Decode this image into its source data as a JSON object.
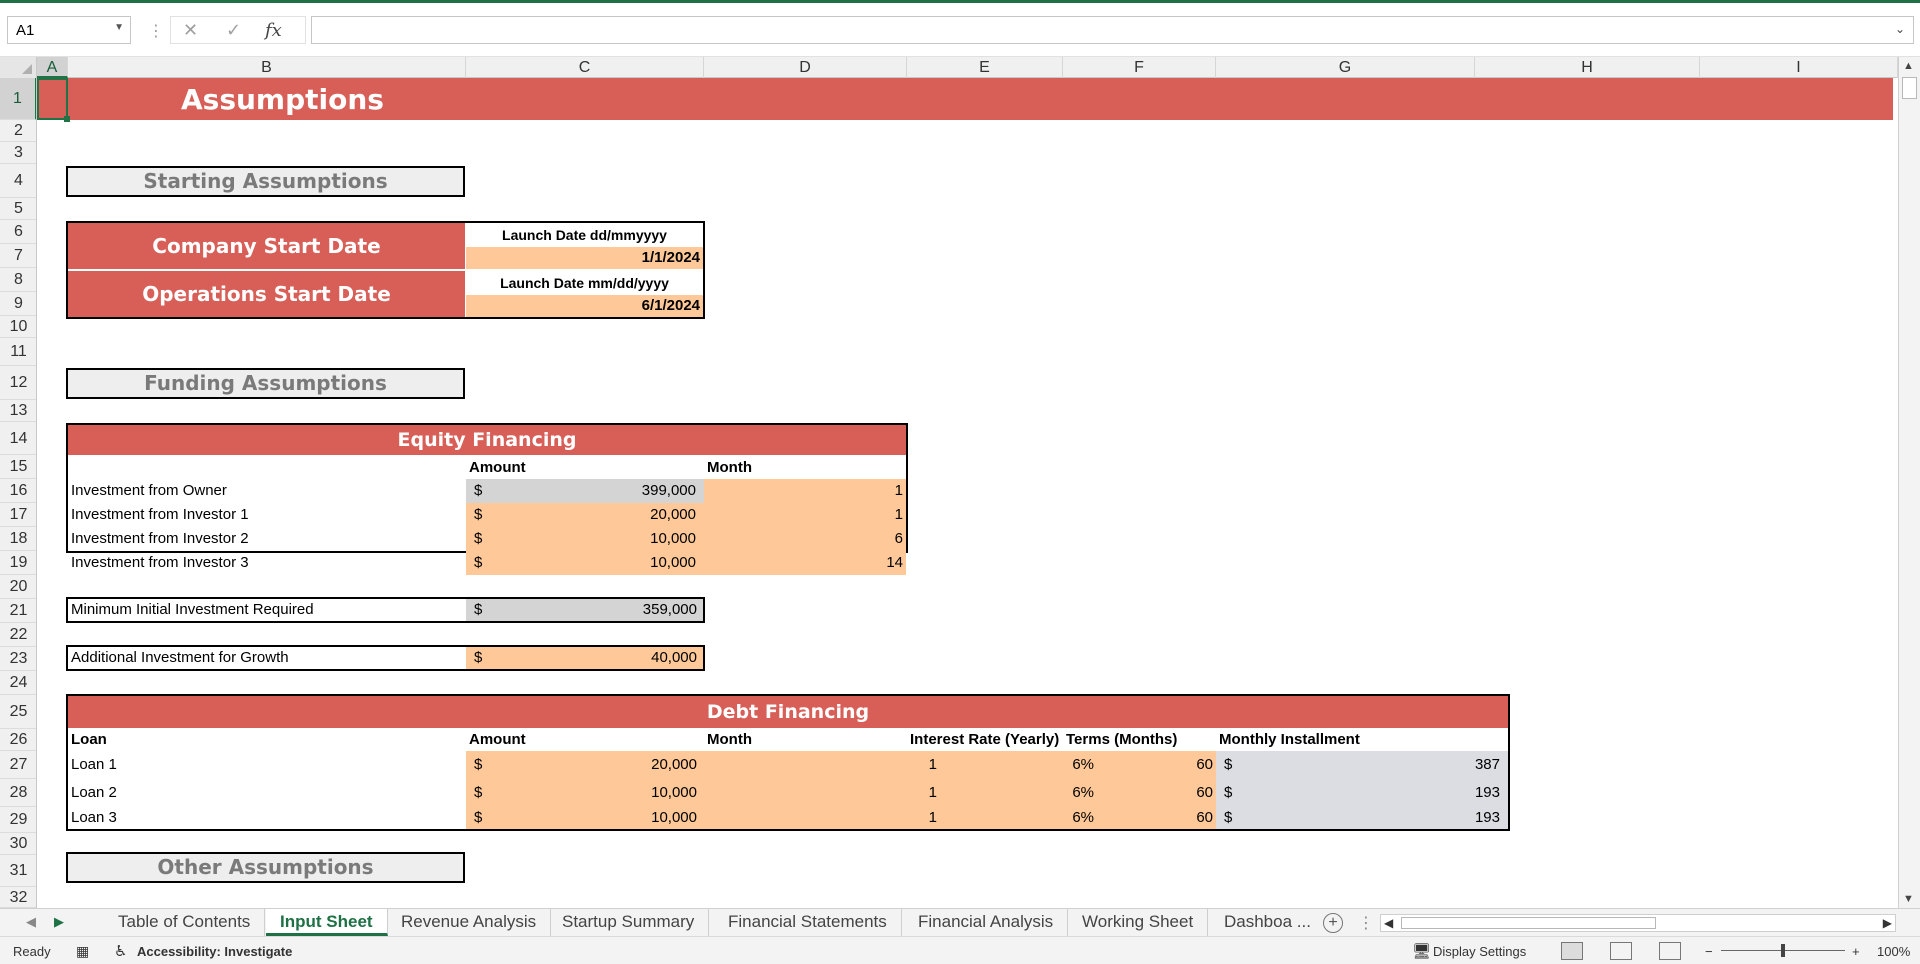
{
  "formula_bar": {
    "name_box": "A1",
    "cancel_icon": "✕",
    "enter_icon": "✓",
    "fx_label": "fx",
    "formula": ""
  },
  "columns": [
    "A",
    "B",
    "C",
    "D",
    "E",
    "F",
    "G",
    "H",
    "I"
  ],
  "rows": [
    "1",
    "2",
    "3",
    "4",
    "5",
    "6",
    "7",
    "8",
    "9",
    "10",
    "11",
    "12",
    "13",
    "14",
    "15",
    "16",
    "17",
    "18",
    "19",
    "20",
    "21",
    "22",
    "23",
    "24",
    "25",
    "26",
    "27",
    "28",
    "29",
    "30",
    "31",
    "32"
  ],
  "sheet": {
    "title": "Assumptions",
    "starting_section": "Starting Assumptions",
    "company_start": {
      "label": "Company Start Date",
      "header": "Launch Date dd/mmyyyy",
      "value": "1/1/2024"
    },
    "operations_start": {
      "label": "Operations Start Date",
      "header": "Launch Date mm/dd/yyyy",
      "value": "6/1/2024"
    },
    "funding_section": "Funding Assumptions",
    "equity": {
      "title": "Equity Financing",
      "amount_header": "Amount",
      "month_header": "Month",
      "rows": [
        {
          "label": "Investment from Owner",
          "currency": "$",
          "amount": "399,000",
          "month": "1"
        },
        {
          "label": "Investment from Investor 1",
          "currency": "$",
          "amount": "20,000",
          "month": "1"
        },
        {
          "label": "Investment from Investor 2",
          "currency": "$",
          "amount": "10,000",
          "month": "6"
        },
        {
          "label": "Investment from Investor 3",
          "currency": "$",
          "amount": "10,000",
          "month": "14"
        }
      ]
    },
    "min_investment": {
      "label": "Minimum Initial Investment Required",
      "currency": "$",
      "amount": "359,000"
    },
    "additional_investment": {
      "label": "Additional Investment for Growth",
      "currency": "$",
      "amount": "40,000"
    },
    "debt": {
      "title": "Debt Financing",
      "headers": {
        "loan": "Loan",
        "amount": "Amount",
        "month": "Month",
        "rate": "Interest Rate (Yearly)",
        "terms": "Terms (Months)",
        "installment": "Monthly Installment"
      },
      "rows": [
        {
          "loan": "Loan 1",
          "currency": "$",
          "amount": "20,000",
          "month": "1",
          "rate": "6%",
          "terms": "60",
          "inst_currency": "$",
          "installment": "387"
        },
        {
          "loan": "Loan 2",
          "currency": "$",
          "amount": "10,000",
          "month": "1",
          "rate": "6%",
          "terms": "60",
          "inst_currency": "$",
          "installment": "193"
        },
        {
          "loan": "Loan 3",
          "currency": "$",
          "amount": "10,000",
          "month": "1",
          "rate": "6%",
          "terms": "60",
          "inst_currency": "$",
          "installment": "193"
        }
      ]
    },
    "other_section": "Other Assumptions"
  },
  "tabs": [
    {
      "label": "Table of Contents",
      "active": false
    },
    {
      "label": "Input Sheet",
      "active": true
    },
    {
      "label": "Revenue Analysis",
      "active": false
    },
    {
      "label": "Startup Summary",
      "active": false
    },
    {
      "label": "Financial Statements",
      "active": false
    },
    {
      "label": "Financial Analysis",
      "active": false
    },
    {
      "label": "Working Sheet",
      "active": false
    },
    {
      "label": "Dashboa ...",
      "active": false
    }
  ],
  "status_bar": {
    "ready": "Ready",
    "accessibility": "Accessibility: Investigate",
    "display_settings": "Display Settings",
    "zoom": "100%"
  },
  "colors": {
    "accent": "#1e7145",
    "banner": "#d75f57",
    "input_fill": "#ffc898",
    "calc_fill": "#d4d4d4"
  }
}
